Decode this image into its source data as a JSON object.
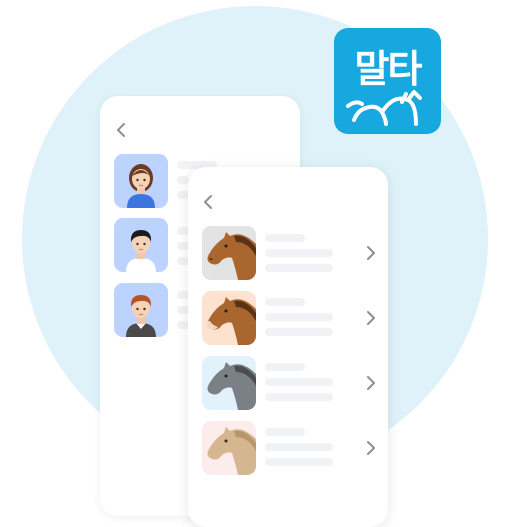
{
  "logo": {
    "text": "말타",
    "color": "#16a8df"
  },
  "people_list": {
    "items": [
      {
        "icon": "woman-avatar-icon",
        "bg": "#bcd2ff"
      },
      {
        "icon": "man-avatar-icon",
        "bg": "#bcd2ff"
      },
      {
        "icon": "man-red-hair-avatar-icon",
        "bg": "#bcd2ff"
      }
    ]
  },
  "horse_list": {
    "items": [
      {
        "icon": "brown-horse-icon",
        "bg": "#e3e3e3"
      },
      {
        "icon": "brown-horse-icon",
        "bg": "#fde3cf"
      },
      {
        "icon": "gray-horse-icon",
        "bg": "#e2f2fb"
      },
      {
        "icon": "beige-horse-icon",
        "bg": "#fdecec"
      }
    ]
  }
}
